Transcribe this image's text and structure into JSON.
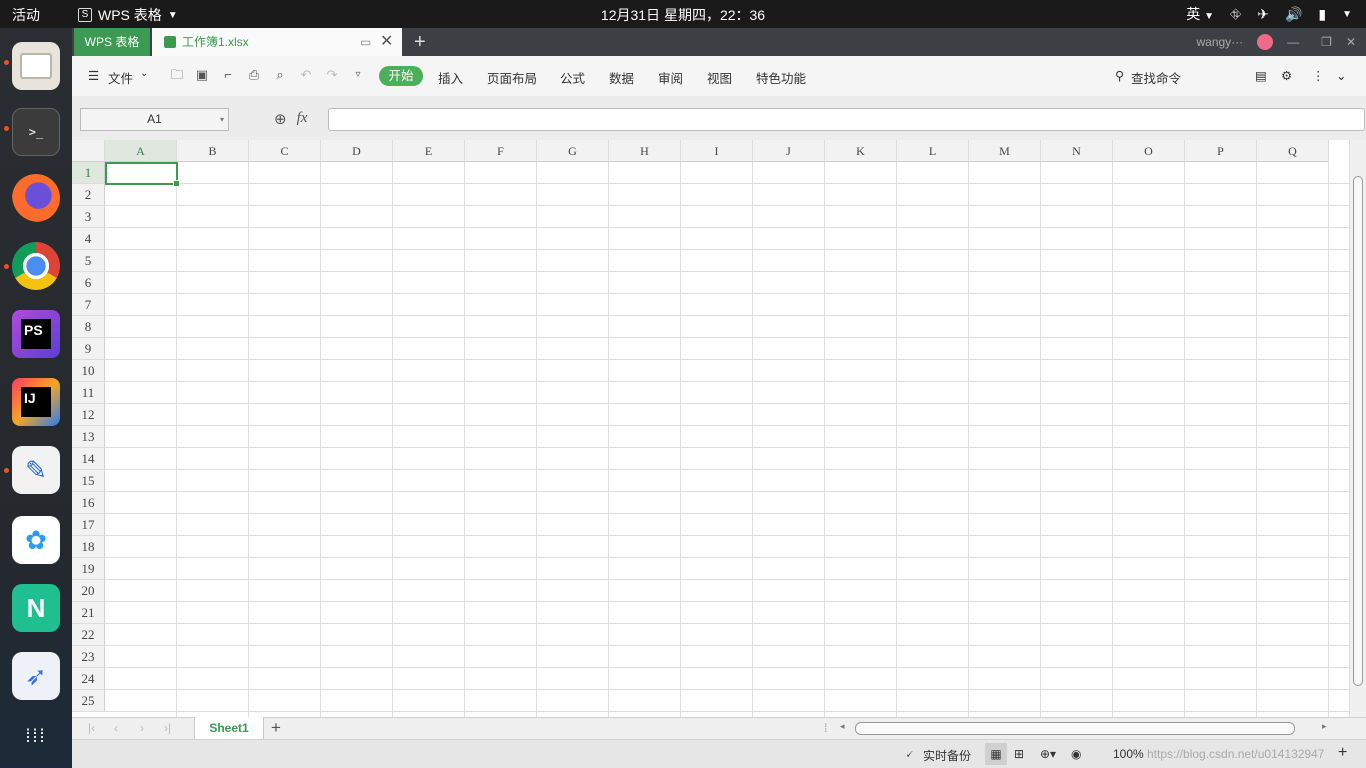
{
  "topbar": {
    "activities": "活动",
    "app_name": "WPS 表格",
    "clock": "12月31日 星期四，22：36",
    "input_method": "英"
  },
  "dock": {
    "items": [
      "files",
      "terminal",
      "firefox",
      "chrome",
      "phpstorm",
      "intellij",
      "text-editor",
      "baidu-netdisk",
      "mindmaster",
      "feishu",
      "app-grid"
    ]
  },
  "window": {
    "app_tab": "WPS 表格",
    "doc_tab": "工作簿1.xlsx",
    "user": "wangy···"
  },
  "ribbon": {
    "file_menu": "文件",
    "menus": [
      "开始",
      "插入",
      "页面布局",
      "公式",
      "数据",
      "审阅",
      "视图",
      "特色功能"
    ],
    "search": "查找命令"
  },
  "formula": {
    "cell_ref": "A1",
    "fx": "fx"
  },
  "grid": {
    "columns": [
      "A",
      "B",
      "C",
      "D",
      "E",
      "F",
      "G",
      "H",
      "I",
      "J",
      "K",
      "L",
      "M",
      "N",
      "O",
      "P",
      "Q"
    ],
    "rows": [
      "1",
      "2",
      "3",
      "4",
      "5",
      "6",
      "7",
      "8",
      "9",
      "10",
      "11",
      "12",
      "13",
      "14",
      "15",
      "16",
      "17",
      "18",
      "19",
      "20",
      "21",
      "22",
      "23",
      "24",
      "25"
    ]
  },
  "sheets": {
    "active": "Sheet1"
  },
  "status": {
    "backup": "实时备份",
    "zoom": "100%",
    "watermark": "https://blog.csdn.net/u014132947"
  },
  "colors": {
    "accent": "#3d9b4f",
    "topbar": "#1a1a1a",
    "tabbar": "#3c3f44"
  }
}
